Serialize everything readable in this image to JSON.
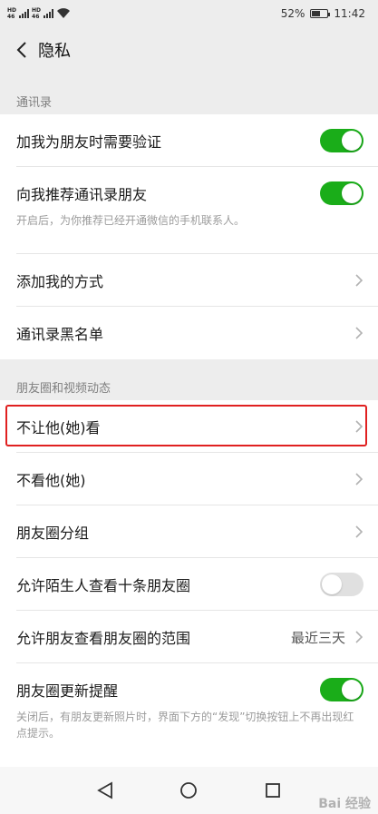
{
  "status_bar": {
    "sim1": "HD 4G",
    "sim2": "HD 4G",
    "battery": "52%",
    "battery_level": 0.52,
    "time": "11:42"
  },
  "nav": {
    "title": "隐私"
  },
  "sections": {
    "contacts_header": "通讯录",
    "moments_header": "朋友圈和视频动态"
  },
  "contacts": {
    "verify_label": "加我为朋友时需要验证",
    "verify_on": true,
    "recommend_label": "向我推荐通讯录朋友",
    "recommend_on": true,
    "recommend_desc": "开启后，为你推荐已经开通微信的手机联系人。",
    "add_method_label": "添加我的方式",
    "blacklist_label": "通讯录黑名单"
  },
  "moments": {
    "hide_from_label": "不让他(她)看",
    "dont_see_label": "不看他(她)",
    "groups_label": "朋友圈分组",
    "strangers_label": "允许陌生人查看十条朋友圈",
    "strangers_on": false,
    "range_label": "允许朋友查看朋友圈的范围",
    "range_value": "最近三天",
    "update_label": "朋友圈更新提醒",
    "update_on": true,
    "update_desc": "关闭后，有朋友更新照片时，界面下方的“发现”切换按钮上不再出现红点提示。"
  },
  "colors": {
    "toggle_on": "#1aad19",
    "highlight": "#e02020"
  },
  "watermark": "Bai 经验"
}
